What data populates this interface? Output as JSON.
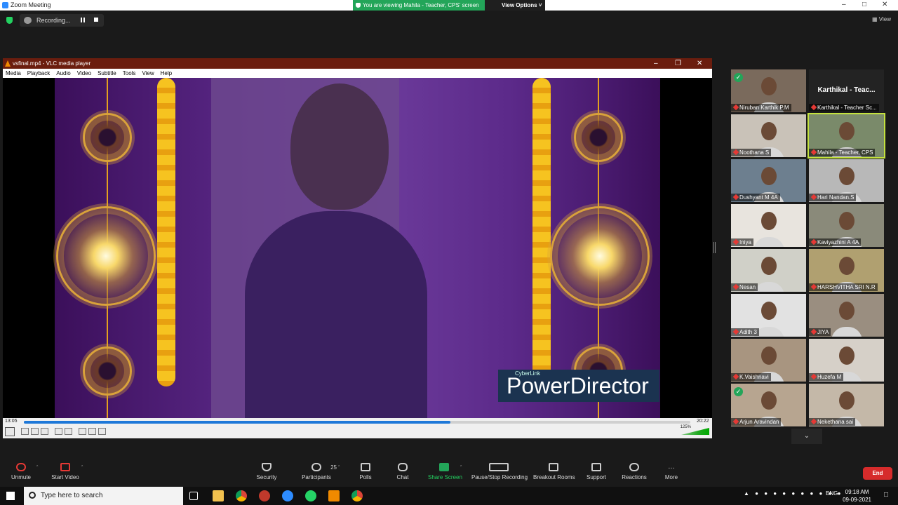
{
  "window": {
    "title": "Zoom Meeting",
    "min": "–",
    "max": "□",
    "close": "✕"
  },
  "share_banner": {
    "text": "You are viewing Mahila - Teacher, CPS' screen",
    "view_options": "View Options ˅"
  },
  "recording": {
    "label": "Recording..."
  },
  "view_label": "View",
  "vlc": {
    "title": "vsfinal.mp4 - VLC media player",
    "menu": [
      "Media",
      "Playback",
      "Audio",
      "Video",
      "Subtitle",
      "Tools",
      "View",
      "Help"
    ],
    "elapsed": "13:05",
    "total": "20:22",
    "progress": 0.64,
    "volume": "125%",
    "overlay_brand": "CyberLink",
    "overlay_product": "PowerDirector"
  },
  "participants": [
    {
      "name": "Niruban Karthik P.M",
      "check": true
    },
    {
      "name": "Karthikal - Teacher Sc...",
      "big_name": "Karthikal - Teac...",
      "no_video": true
    },
    {
      "name": "Noothana S"
    },
    {
      "name": "Mahila - Teacher, CPS",
      "active": true
    },
    {
      "name": "Dushyant M 4A"
    },
    {
      "name": "Hari Nandan.S"
    },
    {
      "name": "Iniya"
    },
    {
      "name": "Kaviyazhini A 4A"
    },
    {
      "name": "Nesan"
    },
    {
      "name": "HARSHVITHA SRI N.R"
    },
    {
      "name": "Adith 3"
    },
    {
      "name": "JIYA"
    },
    {
      "name": "K.Vaishnavi"
    },
    {
      "name": "Huzefa M"
    },
    {
      "name": "Arjun Aravindan",
      "check": true
    },
    {
      "name": "Nekethana  sai"
    }
  ],
  "toolbar": {
    "unmute": "Unmute",
    "start_video": "Start Video",
    "security": "Security",
    "participants": "Participants",
    "participants_count": "25",
    "polls": "Polls",
    "chat": "Chat",
    "share_screen": "Share Screen",
    "pause_stop_recording": "Pause/Stop Recording",
    "breakout_rooms": "Breakout Rooms",
    "support": "Support",
    "reactions": "Reactions",
    "more": "More",
    "end": "End"
  },
  "taskbar": {
    "search_placeholder": "Type here to search",
    "language": "ENG",
    "time": "09:18 AM",
    "date": "09-09-2021"
  },
  "colors": {
    "zoom_blue": "#2d8cff",
    "share_green": "#23a559",
    "end_red": "#d62b2b",
    "vlc_title": "#6b1d0e",
    "active_speaker": "#c4e23e"
  }
}
